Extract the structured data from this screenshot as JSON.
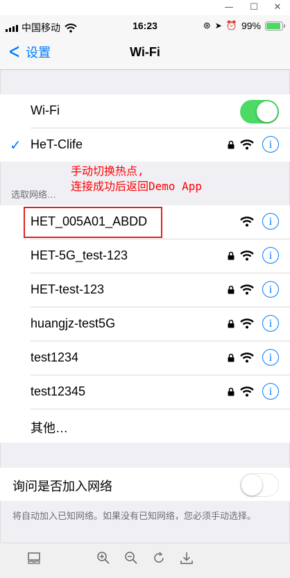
{
  "window": {
    "minimize": "—",
    "maximize": "☐",
    "close": "✕"
  },
  "status": {
    "carrier": "中国移动",
    "time": "16:23",
    "battery": "99%",
    "battery_level": 0.99
  },
  "nav": {
    "back_label": "设置",
    "title": "Wi-Fi"
  },
  "wifi_toggle": {
    "label": "Wi-Fi",
    "on": true
  },
  "connected": {
    "name": "HeT-Clife",
    "locked": true
  },
  "annotation": {
    "line1": "手动切换热点,",
    "line2": "连接成功后返回Demo App"
  },
  "section_header": "选取网络…",
  "networks": [
    {
      "name": "HET_005A01_ABDD",
      "locked": false
    },
    {
      "name": "HET-5G_test-123",
      "locked": true
    },
    {
      "name": "HET-test-123",
      "locked": true
    },
    {
      "name": "huangjz-test5G",
      "locked": true
    },
    {
      "name": "test1234",
      "locked": true
    },
    {
      "name": "test12345",
      "locked": true
    }
  ],
  "other_label": "其他…",
  "ask_join": {
    "label": "询问是否加入网络",
    "on": false
  },
  "footer_note": "将自动加入已知网络。如果没有已知网络，您必须手动选择。",
  "info_glyph": "i",
  "colors": {
    "accent": "#007aff",
    "toggle_on": "#4cd964",
    "annotation": "#ff0000"
  },
  "toolbar_icons": [
    "sidebar-icon",
    "zoom-in-icon",
    "zoom-out-icon",
    "rotate-icon",
    "download-icon"
  ]
}
